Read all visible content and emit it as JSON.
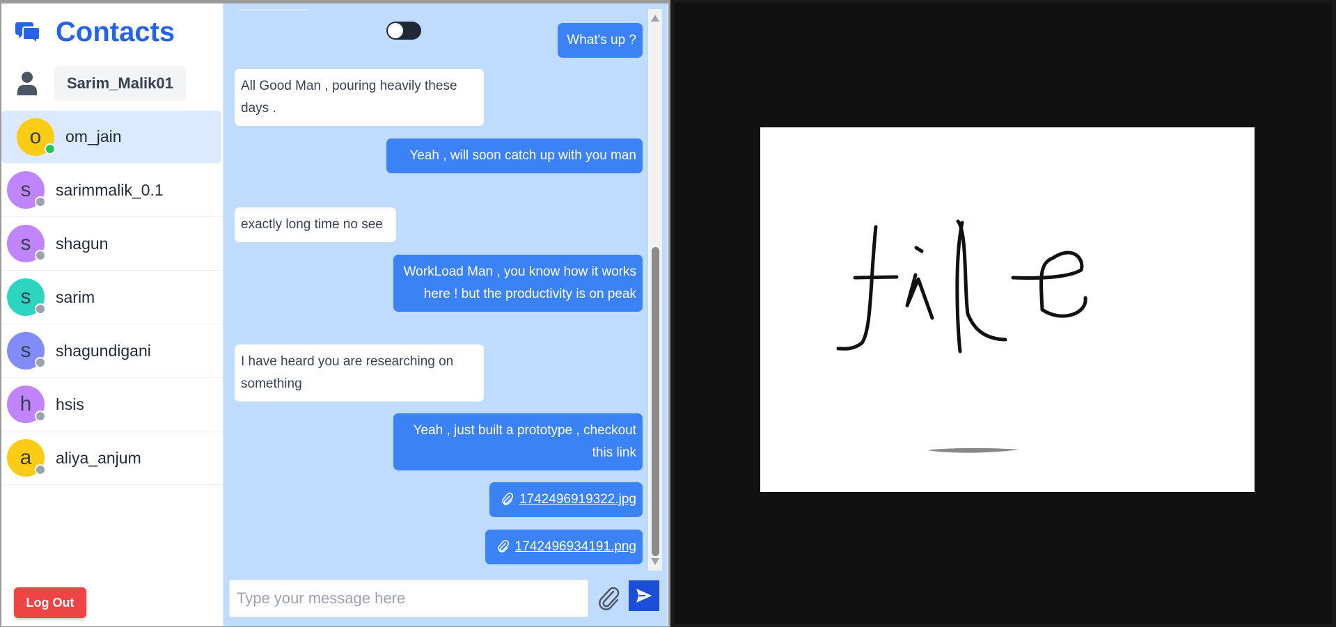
{
  "sidebar": {
    "title": "Contacts",
    "current_user": "Sarim_Malik01",
    "contacts": [
      {
        "initial": "o",
        "name": "om_jain",
        "color": "#facc15",
        "status": "online",
        "active": true
      },
      {
        "initial": "s",
        "name": "sarimmalik_0.1",
        "color": "#c084fc",
        "status": "offline"
      },
      {
        "initial": "s",
        "name": "shagun",
        "color": "#c084fc",
        "status": "offline"
      },
      {
        "initial": "s",
        "name": "sarim",
        "color": "#2dd4bf",
        "status": "offline"
      },
      {
        "initial": "s",
        "name": "shagundigani",
        "color": "#818cf8",
        "status": "offline"
      },
      {
        "initial": "h",
        "name": "hsis",
        "color": "#c084fc",
        "status": "offline"
      },
      {
        "initial": "a",
        "name": "aliya_anjum",
        "color": "#facc15",
        "status": "offline"
      }
    ],
    "logout_label": "Log Out"
  },
  "chat": {
    "messages": [
      {
        "dir": "out",
        "text": "What's up ?"
      },
      {
        "dir": "in",
        "text": "All Good Man , pouring heavily these days ."
      },
      {
        "dir": "out",
        "text": "Yeah , will soon catch up with you man"
      },
      {
        "dir": "in",
        "text": "exactly long time no see"
      },
      {
        "dir": "out",
        "text": "WorkLoad Man , you know how it works here ! but the productivity is on peak"
      },
      {
        "dir": "in",
        "text": "I have heard you are researching on something"
      },
      {
        "dir": "out",
        "text": "Yeah , just built a prototype , checkout this link"
      },
      {
        "dir": "out",
        "type": "file",
        "text": "1742496919322.jpg"
      },
      {
        "dir": "out",
        "type": "file",
        "text": "1742496934191.png"
      }
    ],
    "composer": {
      "placeholder": "Type your message here"
    }
  },
  "viewer": {
    "image_text": "file"
  },
  "colors": {
    "accent": "#2563eb",
    "bubble_out": "#3b82f6",
    "chat_bg": "#bfdbfe",
    "logout": "#ef4444",
    "online": "#22c55e",
    "offline": "#9ca3af"
  }
}
